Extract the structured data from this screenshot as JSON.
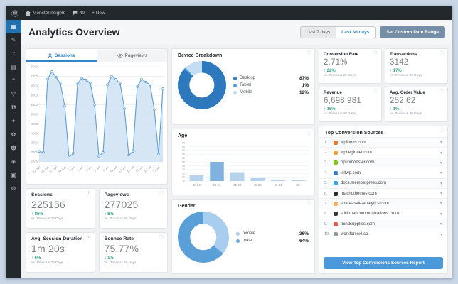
{
  "adminbar": {
    "site_name": "MonsterInsights",
    "comments_count": "40",
    "new_label": "+ New"
  },
  "sidebar": {
    "items": [
      {
        "name": "insights",
        "glyph": "▦",
        "active": true
      },
      {
        "name": "posts",
        "glyph": "✎",
        "active": false
      },
      {
        "name": "media",
        "glyph": "♪",
        "active": false
      },
      {
        "name": "pages",
        "glyph": "▤",
        "active": false
      },
      {
        "name": "comments",
        "glyph": "❝",
        "active": false
      },
      {
        "name": "feedback",
        "glyph": "▽",
        "active": false
      },
      {
        "name": "thirsty-affiliates",
        "glyph": "TA",
        "active": false
      },
      {
        "name": "plugins",
        "glyph": "✦",
        "active": false
      },
      {
        "name": "appearance",
        "glyph": "✿",
        "active": false
      },
      {
        "name": "users",
        "glyph": "☻",
        "active": false
      },
      {
        "name": "tools",
        "glyph": "◈",
        "active": false
      },
      {
        "name": "analytics",
        "glyph": "▣",
        "active": false
      },
      {
        "name": "settings",
        "glyph": "⚙",
        "active": false
      }
    ]
  },
  "header": {
    "title": "Analytics Overview",
    "btn_last7": "Last 7 days",
    "btn_last30": "Last 30 days",
    "btn_custom": "Set Custom Date Range"
  },
  "tabs": {
    "sessions": "Sessions",
    "pageviews": "Pageviews"
  },
  "stats": {
    "sessions": {
      "label": "Sessions",
      "value": "225156",
      "change": "↑ 85%",
      "vs": "vs. Previous 30 Days"
    },
    "pageviews": {
      "label": "Pageviews",
      "value": "277025",
      "change": "↑ 8%",
      "vs": "vs. Previous 30 Days"
    },
    "duration": {
      "label": "Avg. Session Duration",
      "value": "1m 20s",
      "change": "↑ 6%",
      "vs": "vs. Previous 30 Days"
    },
    "bounce": {
      "label": "Bounce Rate",
      "value": "75.77%",
      "change": "↓ 1%",
      "vs": "vs. Previous 30 Days"
    },
    "conversion": {
      "label": "Conversion Rate",
      "value": "2.71%",
      "change": "↑ 22%",
      "vs": "vs. Previous 30 Days"
    },
    "transactions": {
      "label": "Transactions",
      "value": "3142",
      "change": "↑ 17%",
      "vs": "vs. Previous 30 Days"
    },
    "revenue": {
      "label": "Revenue",
      "value": "6,698,981",
      "change": "↑ 15%",
      "vs": "vs. Previous 30 Days"
    },
    "aov": {
      "label": "Avg. Order Value",
      "value": "252.62",
      "change": "↑ 1%",
      "vs": "vs. Previous 30 Days"
    }
  },
  "sources": {
    "title": "Top Conversion Sources",
    "button_label": "View Top Conversions Sources Report",
    "items": [
      {
        "rank": "1.",
        "domain": "wpforms.com",
        "color": "#e27730"
      },
      {
        "rank": "2.",
        "domain": "wpbeginner.com",
        "color": "#f7a038"
      },
      {
        "rank": "3.",
        "domain": "optinmonster.com",
        "color": "#83c11f"
      },
      {
        "rank": "4.",
        "domain": "isitwp.com",
        "color": "#3a7bd5"
      },
      {
        "rank": "5.",
        "domain": "docs.memberpress.com",
        "color": "#36a9e1"
      },
      {
        "rank": "6.",
        "domain": "machothemes.com",
        "color": "#2b2b2b"
      },
      {
        "rank": "7.",
        "domain": "shareasale-analytics.com",
        "color": "#f4b459"
      },
      {
        "rank": "8.",
        "domain": "stickmancommunications.co.uk",
        "color": "#3a3a3a"
      },
      {
        "rank": "9.",
        "domain": "mindsupplies.com",
        "color": "#e2574c"
      },
      {
        "rank": "10.",
        "domain": "workforcexl.co",
        "color": "#8d99a5"
      }
    ]
  },
  "chart_data": [
    {
      "type": "area",
      "title": "Sessions over last 30 days",
      "x": [
        "23 Jun",
        "24 Jun",
        "25 Jun",
        "26 Jun",
        "27 Jun",
        "28 Jun",
        "29 Jun",
        "30 Jun",
        "1 Jul",
        "2 Jul",
        "3 Jul",
        "4 Jul",
        "5 Jul",
        "6 Jul",
        "7 Jul",
        "8 Jul",
        "9 Jul",
        "10 Jul",
        "11 Jul",
        "12 Jul",
        "13 Jul",
        "14 Jul",
        "15 Jul",
        "16 Jul",
        "17 Jul",
        "18 Jul",
        "19 Jul",
        "20 Jul",
        "21 Jul",
        "22 Jul"
      ],
      "tick_labels": [
        "23 Jun",
        "25 Jun",
        "27 Jun",
        "29 Jun",
        "1 Jul",
        "3 Jul",
        "5 Jul",
        "7 Jul",
        "9 Jul",
        "11 Jul",
        "13 Jul",
        "15 Jul",
        "17 Jul",
        "19 Jul",
        "21 Jul"
      ],
      "values": [
        3050,
        3000,
        6850,
        7250,
        6950,
        6600,
        5450,
        2750,
        2950,
        6600,
        6900,
        6800,
        6650,
        5500,
        2800,
        3000,
        6550,
        7000,
        6850,
        6600,
        5300,
        2850,
        3050,
        6450,
        6850,
        6700,
        6550,
        5250,
        2900,
        6350
      ],
      "ylim": [
        2500,
        7500
      ],
      "ytick_step": 500,
      "grid": true,
      "line_color": "#5b9fd8",
      "fill_color": "#cfe2f3"
    },
    {
      "type": "pie",
      "title": "Device Breakdown",
      "categories": [
        "Desktop",
        "Tablet",
        "Mobile"
      ],
      "values": [
        87,
        1,
        12
      ],
      "colors": [
        "#2e78bd",
        "#56a0dc",
        "#c3ddf4"
      ],
      "legend_position": "right"
    },
    {
      "type": "bar",
      "title": "Age",
      "categories": [
        "18-24",
        "25-34",
        "35-44",
        "45-54",
        "55-64",
        "65+"
      ],
      "values": [
        15,
        50,
        23,
        9,
        4,
        2
      ],
      "ylim": [
        0,
        100
      ],
      "ytick_step": 10,
      "bar_color": "#b5d4ec",
      "highlight_index": 1,
      "highlight_color": "#7fb2de"
    },
    {
      "type": "pie",
      "title": "Gender",
      "categories": [
        "female",
        "male"
      ],
      "values": [
        36,
        64
      ],
      "colors": [
        "#a9cdee",
        "#5b9fd8"
      ],
      "legend_position": "right"
    }
  ],
  "colors": {
    "accent_blue": "#2b88c9",
    "positive_green": "#2fa789",
    "slate_button": "#7590a6"
  }
}
